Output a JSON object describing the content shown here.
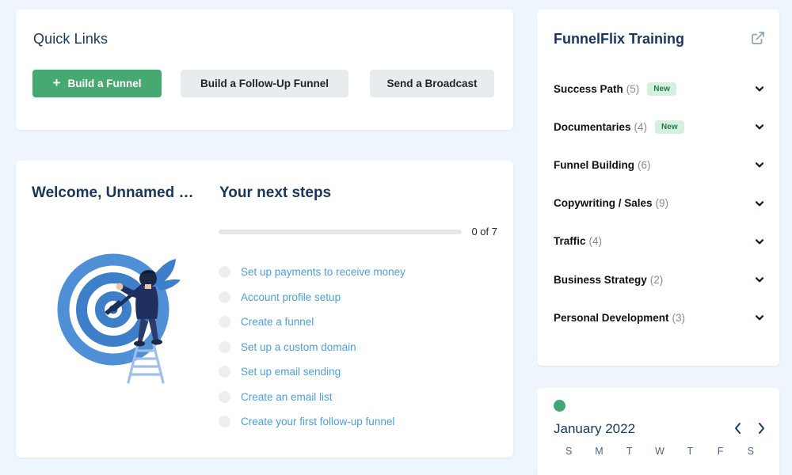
{
  "quick_links": {
    "title": "Quick Links",
    "buttons": [
      {
        "label": "Build a Funnel",
        "icon": "plus-icon",
        "variant": "primary"
      },
      {
        "label": "Build a Follow-Up Funnel",
        "variant": "secondary"
      },
      {
        "label": "Send a Broadcast",
        "variant": "secondary"
      }
    ]
  },
  "welcome": {
    "heading": "Welcome, Unnamed …",
    "illustration": "target-with-dart-illustration"
  },
  "next_steps": {
    "heading": "Your next steps",
    "progress_label": "0 of 7",
    "completed": 0,
    "total": 7,
    "percent": 0,
    "items": [
      {
        "label": "Set up payments to receive money",
        "done": false
      },
      {
        "label": "Account profile setup",
        "done": false
      },
      {
        "label": "Create a funnel",
        "done": false
      },
      {
        "label": "Set up a custom domain",
        "done": false
      },
      {
        "label": "Set up email sending",
        "done": false
      },
      {
        "label": "Create an email list",
        "done": false
      },
      {
        "label": "Create your first follow-up funnel",
        "done": false
      }
    ]
  },
  "funnelflix": {
    "title": "FunnelFlix Training",
    "external_link_icon": "external-link-icon",
    "categories": [
      {
        "name": "Success Path",
        "count": "(5)",
        "badge": "New"
      },
      {
        "name": "Documentaries",
        "count": "(4)",
        "badge": "New"
      },
      {
        "name": "Funnel Building",
        "count": "(6)",
        "badge": null
      },
      {
        "name": "Copywriting / Sales",
        "count": "(9)",
        "badge": null
      },
      {
        "name": "Traffic",
        "count": "(4)",
        "badge": null
      },
      {
        "name": "Business Strategy",
        "count": "(2)",
        "badge": null
      },
      {
        "name": "Personal Development",
        "count": "(3)",
        "badge": null
      }
    ]
  },
  "calendar": {
    "status_dot_color": "#3fa776",
    "month": "January 2022",
    "prev_label": "‹",
    "next_label": "›",
    "day_names": [
      "S",
      "M",
      "T",
      "W",
      "T",
      "F",
      "S"
    ]
  },
  "colors": {
    "page_background": "#eef5fc",
    "card_background": "#ffffff",
    "primary_green": "#45a971",
    "secondary_gray": "#e9ecef",
    "heading_navy": "#17365c",
    "link_blue": "#4a9fe0",
    "badge_bg": "#d5f0e1",
    "badge_text": "#1d7a4c"
  }
}
